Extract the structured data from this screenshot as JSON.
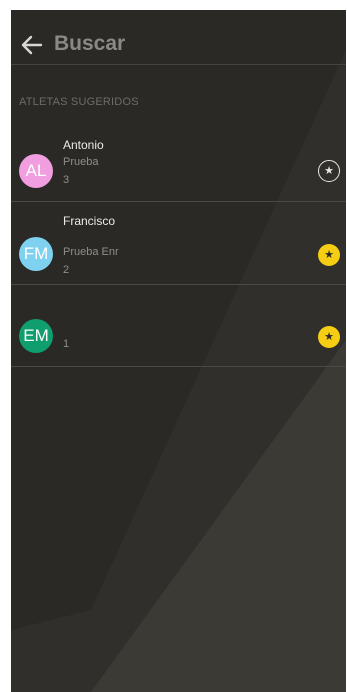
{
  "header": {
    "title": "Buscar",
    "back_icon": "arrow-left-icon"
  },
  "section": {
    "label": "ATLETAS SUGERIDOS"
  },
  "athletes": [
    {
      "initials": "AL",
      "name": "Antonio",
      "line2": "Prueba",
      "line3": "3",
      "avatar_color": "#f09ee0",
      "starred": false,
      "star_icon": "star-outline-icon"
    },
    {
      "initials": "FM",
      "name": "Francisco",
      "line2": "Prueba Enr",
      "line3": "2",
      "avatar_color": "#7fd1f0",
      "starred": true,
      "star_icon": "star-filled-icon"
    },
    {
      "initials": "EM",
      "name": "",
      "line2": "",
      "line3": "1",
      "avatar_color": "#0f9e6e",
      "starred": true,
      "star_icon": "star-filled-icon"
    }
  ],
  "colors": {
    "background": "#2a2926",
    "star_active": "#f5cd12",
    "title": "#8a8984"
  }
}
